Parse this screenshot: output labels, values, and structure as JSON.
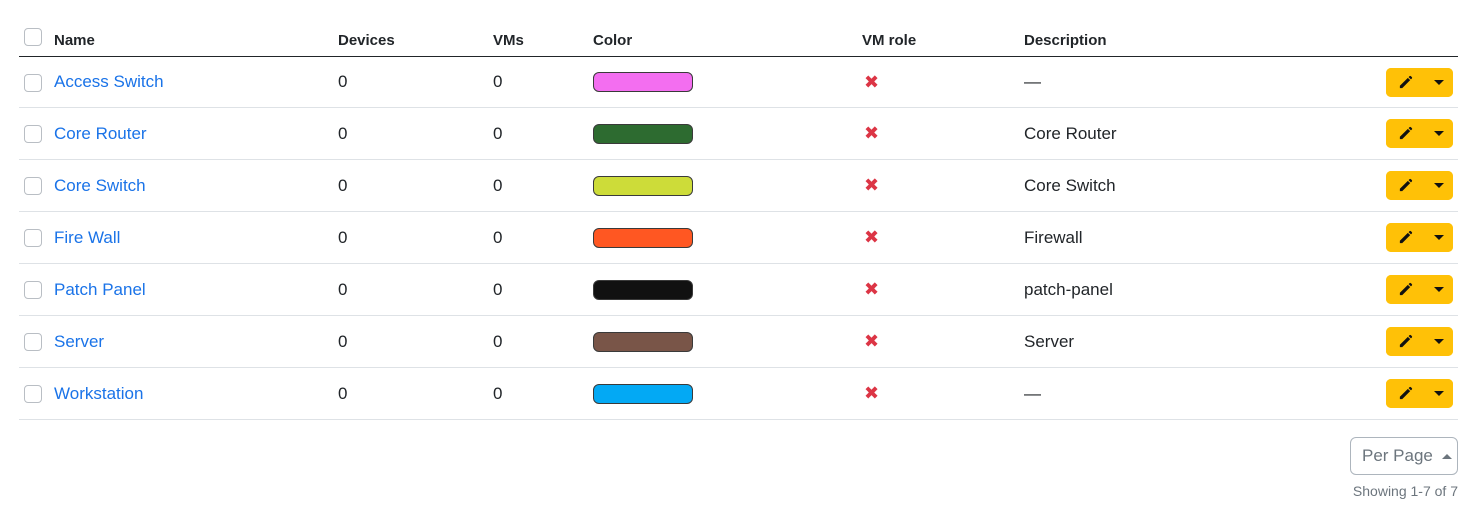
{
  "table": {
    "headers": {
      "name": "Name",
      "devices": "Devices",
      "vms": "VMs",
      "color": "Color",
      "vm_role": "VM role",
      "description": "Description"
    },
    "rows": [
      {
        "name": "Access Switch",
        "devices": "0",
        "vms": "0",
        "color": "#f36ef0",
        "vm_role": "✖",
        "description": "—"
      },
      {
        "name": "Core Router",
        "devices": "0",
        "vms": "0",
        "color": "#2d6b30",
        "vm_role": "✖",
        "description": "Core Router"
      },
      {
        "name": "Core Switch",
        "devices": "0",
        "vms": "0",
        "color": "#cddc39",
        "vm_role": "✖",
        "description": "Core Switch"
      },
      {
        "name": "Fire Wall",
        "devices": "0",
        "vms": "0",
        "color": "#ff5722",
        "vm_role": "✖",
        "description": "Firewall"
      },
      {
        "name": "Patch Panel",
        "devices": "0",
        "vms": "0",
        "color": "#111111",
        "vm_role": "✖",
        "description": "patch-panel"
      },
      {
        "name": "Server",
        "devices": "0",
        "vms": "0",
        "color": "#795548",
        "vm_role": "✖",
        "description": "Server"
      },
      {
        "name": "Workstation",
        "devices": "0",
        "vms": "0",
        "color": "#03a9f4",
        "vm_role": "✖",
        "description": "—"
      }
    ],
    "row_actions": {
      "edit_icon": "pencil-icon",
      "toggle_icon": "caret-down-icon",
      "button_color": "#ffc107"
    }
  },
  "pagination": {
    "per_page_label": "Per Page",
    "per_page_icon": "caret-up-icon",
    "showing": "Showing 1-7 of 7"
  },
  "colors": {
    "link": "#1a73e8",
    "vm_role_false": "#dc3545"
  }
}
